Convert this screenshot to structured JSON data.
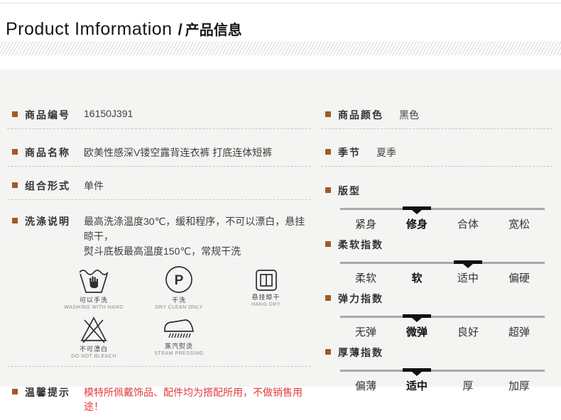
{
  "colors": {
    "bullet_brown": "#a05a28",
    "warning_red": "#e23c3c",
    "marker_black": "#111111",
    "track_gray": "#a8a8a8",
    "panel_bg": "#f4f4f2"
  },
  "header": {
    "title_en": "Product Imformation",
    "title_sep": "/",
    "title_cn": "产品信息"
  },
  "left": {
    "rows": [
      {
        "label": "商品编号",
        "value": "16150J391"
      },
      {
        "label": "商品名称",
        "value": "欧美性感深V镂空露背连衣裤 打底连体短裤"
      },
      {
        "label": "组合形式",
        "value": "单件"
      }
    ],
    "washing": {
      "label": "洗涤说明",
      "line1": "最高洗涤温度30℃，缓和程序，不可以漂白，悬挂晾干，",
      "line2": "熨斗底板最高温度150℃，常规干洗",
      "icons": [
        {
          "cn": "可以手洗",
          "en": "WASHING WITH HAND"
        },
        {
          "cn": "干洗",
          "en": "DRY CLEAN ONLY",
          "letter": "P"
        },
        {
          "cn": "悬挂晾干",
          "en": "HANG DRY"
        },
        {
          "cn": "不可漂白",
          "en": "DO NOT BLEACH"
        },
        {
          "cn": "蒸汽熨烫",
          "en": "STEAM PRESSING"
        }
      ]
    },
    "tips": {
      "label": "温馨提示",
      "value": "模特所佩戴饰品、配件均为搭配所用，不做销售用途！"
    }
  },
  "right": {
    "rows": [
      {
        "label": "商品颜色",
        "value": "黑色"
      },
      {
        "label": "季节",
        "value": "夏季"
      }
    ],
    "scales": [
      {
        "label": "版型",
        "options": [
          "紧身",
          "修身",
          "合体",
          "宽松"
        ],
        "marker_index": 1,
        "bold_index": 1
      },
      {
        "label": "柔软指数",
        "options": [
          "柔软",
          "软",
          "适中",
          "偏硬"
        ],
        "marker_index": 2,
        "bold_index": 1
      },
      {
        "label": "弹力指数",
        "options": [
          "无弹",
          "微弹",
          "良好",
          "超弹"
        ],
        "marker_index": 1,
        "bold_index": 1
      },
      {
        "label": "厚薄指数",
        "options": [
          "偏薄",
          "适中",
          "厚",
          "加厚"
        ],
        "marker_index": 1,
        "bold_index": 1
      }
    ]
  }
}
